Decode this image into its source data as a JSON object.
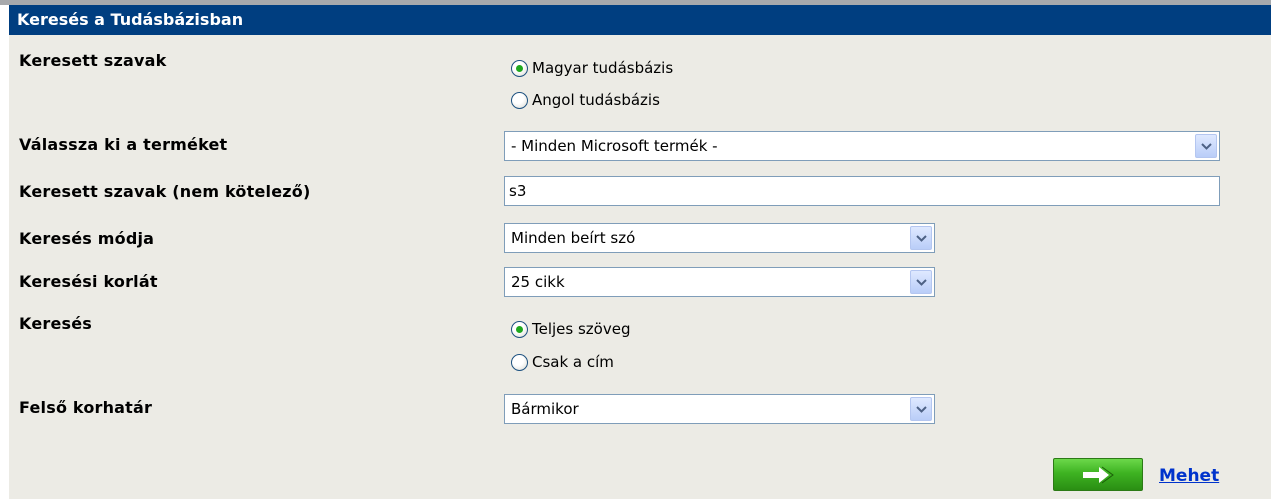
{
  "title": "Keresés a Tudásbázisban",
  "fields": {
    "search_words": {
      "label": "Keresett szavak",
      "options": [
        {
          "label": "Magyar tudásbázis",
          "checked": true
        },
        {
          "label": "Angol tudásbázis",
          "checked": false
        }
      ]
    },
    "product": {
      "label": "Válassza ki a terméket",
      "value": "- Minden Microsoft termék -"
    },
    "keywords": {
      "label": "Keresett szavak (nem kötelező)",
      "value": "s3"
    },
    "search_mode": {
      "label": "Keresés módja",
      "value": "Minden beírt szó"
    },
    "search_limit": {
      "label": "Keresési korlát",
      "value": "25 cikk"
    },
    "search_in": {
      "label": "Keresés",
      "options": [
        {
          "label": "Teljes szöveg",
          "checked": true
        },
        {
          "label": "Csak a cím",
          "checked": false
        }
      ]
    },
    "age_limit": {
      "label": "Felső korhatár",
      "value": "Bármikor"
    }
  },
  "go": {
    "label": "Mehet",
    "icon": "arrow-right-icon"
  },
  "colors": {
    "titlebar": "#003e80",
    "panel": "#ecebe5",
    "go_button": "#3eb322",
    "link": "#0033cc"
  }
}
